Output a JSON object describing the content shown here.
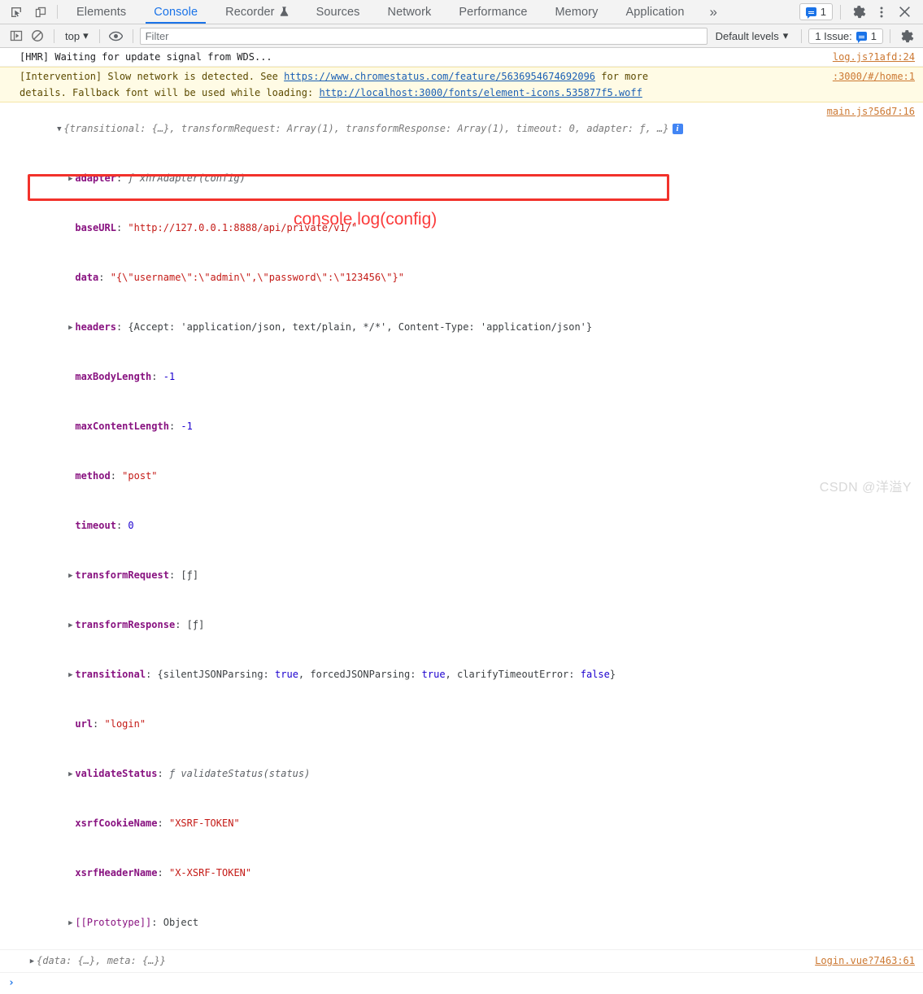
{
  "tabbar": {
    "icons": [
      {
        "name": "inspect-element-icon",
        "label": "Inspect element"
      },
      {
        "name": "device-toolbar-icon",
        "label": "Toggle device toolbar"
      }
    ],
    "tabs": [
      {
        "label": "Elements",
        "active": false
      },
      {
        "label": "Console",
        "active": true
      },
      {
        "label": "Recorder",
        "active": false,
        "icon": "flask-icon"
      },
      {
        "label": "Sources",
        "active": false
      },
      {
        "label": "Network",
        "active": false
      },
      {
        "label": "Performance",
        "active": false
      },
      {
        "label": "Memory",
        "active": false
      },
      {
        "label": "Application",
        "active": false
      }
    ],
    "more_label": "»",
    "issues_count": "1",
    "settings_label": "Settings",
    "more_options_label": "⋮",
    "close_label": "✕"
  },
  "toolbar": {
    "sidebar_toggle": "console-sidebar-toggle",
    "clear_console": "clear-console-icon",
    "context": "top",
    "context_caret": "▾",
    "eye_icon": "live-expression-icon",
    "filter_placeholder": "Filter",
    "filter_value": "",
    "levels_label": "Default levels",
    "levels_caret": "▾",
    "issues_label": "1 Issue:",
    "issues_count": "1",
    "settings_label": "Console settings"
  },
  "console": {
    "messages": [
      {
        "type": "log",
        "text": "[HMR] Waiting for update signal from WDS...",
        "source": "log.js?1afd:24"
      },
      {
        "type": "warning",
        "line1_a": "[Intervention] Slow network is detected. See ",
        "line1_link": "https://www.chromestatus.com/feature/5636954674692096",
        "line1_b": " for more",
        "line2_a": "details. Fallback font will be used while loading: ",
        "line2_link": "http://localhost:3000/fonts/element-icons.535877f5.woff",
        "source": ":3000/#/home:1"
      }
    ],
    "object_message": {
      "source": "main.js?56d7:16",
      "preview": "{transitional: {…}, transformRequest: Array(1), transformResponse: Array(1), timeout: 0, adapter: ƒ, …}",
      "info_badge": "i",
      "properties": [
        {
          "arrow": "right",
          "key": "adapter",
          "sep": ": ",
          "value": "ƒ xhrAdapter(config)",
          "kind": "fn"
        },
        {
          "arrow": "none",
          "key": "baseURL",
          "sep": ": ",
          "value": "\"http://127.0.0.1:8888/api/private/v1/\"",
          "kind": "str"
        },
        {
          "arrow": "none",
          "key": "data",
          "sep": ": ",
          "value": "\"{\\\"username\\\":\\\"admin\\\",\\\"password\\\":\\\"123456\\\"}\"",
          "kind": "str"
        },
        {
          "arrow": "right",
          "key": "headers",
          "sep": ": ",
          "value": "{Accept: 'application/json, text/plain, */*', Content-Type: 'application/json'}",
          "kind": "obj",
          "highlighted": true
        },
        {
          "arrow": "none",
          "key": "maxBodyLength",
          "sep": ": ",
          "value": "-1",
          "kind": "num"
        },
        {
          "arrow": "none",
          "key": "maxContentLength",
          "sep": ": ",
          "value": "-1",
          "kind": "num"
        },
        {
          "arrow": "none",
          "key": "method",
          "sep": ": ",
          "value": "\"post\"",
          "kind": "str"
        },
        {
          "arrow": "none",
          "key": "timeout",
          "sep": ": ",
          "value": "0",
          "kind": "num"
        },
        {
          "arrow": "right",
          "key": "transformRequest",
          "sep": ": ",
          "value": "[ƒ]",
          "kind": "obj"
        },
        {
          "arrow": "right",
          "key": "transformResponse",
          "sep": ": ",
          "value": "[ƒ]",
          "kind": "obj"
        },
        {
          "arrow": "right",
          "key": "transitional",
          "sep": ": ",
          "value": "{silentJSONParsing: true, forcedJSONParsing: true, clarifyTimeoutError: false}",
          "kind": "obj"
        },
        {
          "arrow": "none",
          "key": "url",
          "sep": ": ",
          "value": "\"login\"",
          "kind": "str"
        },
        {
          "arrow": "right",
          "key": "validateStatus",
          "sep": ": ",
          "value": "ƒ validateStatus(status)",
          "kind": "fn"
        },
        {
          "arrow": "none",
          "key": "xsrfCookieName",
          "sep": ": ",
          "value": "\"XSRF-TOKEN\"",
          "kind": "str"
        },
        {
          "arrow": "none",
          "key": "xsrfHeaderName",
          "sep": ": ",
          "value": "\"X-XSRF-TOKEN\"",
          "kind": "str"
        },
        {
          "arrow": "right",
          "key": "[[Prototype]]",
          "sep": ": ",
          "value": "Object",
          "kind": "proto"
        }
      ]
    },
    "second_object": {
      "preview": "{data: {…}, meta: {…}}",
      "source": "Login.vue?7463:61"
    },
    "prompt_caret": "›",
    "prompt_value": ""
  },
  "annotations": {
    "red_label": "console.log(config)",
    "red_color": "#fb3b3b",
    "box_color": "#f2322b"
  },
  "watermark": "CSDN @洋溢Y",
  "colors": {
    "accent": "#1a73e8",
    "warning_bg": "#fffbe5",
    "property_name": "#881280",
    "string": "#c41a16",
    "number": "#1c00cf",
    "link": "#1a5fb4",
    "source_link": "#cc7832"
  }
}
